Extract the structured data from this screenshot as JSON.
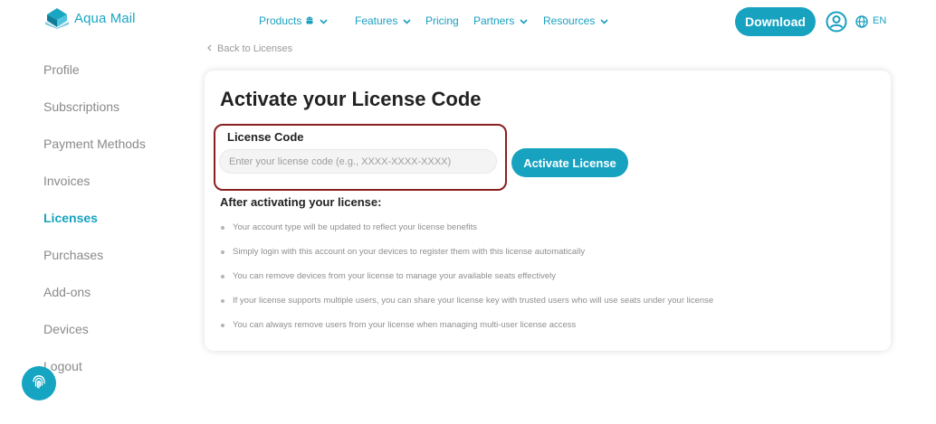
{
  "header": {
    "logo_text": "Aqua Mail",
    "nav": [
      {
        "label": "Products",
        "has_android": true,
        "has_chevron": true
      },
      {
        "label": "Features",
        "has_chevron": true
      },
      {
        "label": "Pricing",
        "has_chevron": false
      },
      {
        "label": "Partners",
        "has_chevron": true
      },
      {
        "label": "Resources",
        "has_chevron": true
      }
    ],
    "download_label": "Download",
    "language": "EN"
  },
  "colors": {
    "accent": "#17a3c0",
    "highlight_border": "#8b1f1f",
    "muted_text": "#8a8a8a"
  },
  "sidebar": {
    "items": [
      {
        "label": "Profile",
        "active": false
      },
      {
        "label": "Subscriptions",
        "active": false
      },
      {
        "label": "Payment Methods",
        "active": false
      },
      {
        "label": "Invoices",
        "active": false
      },
      {
        "label": "Licenses",
        "active": true
      },
      {
        "label": "Purchases",
        "active": false
      },
      {
        "label": "Add-ons",
        "active": false
      },
      {
        "label": "Devices",
        "active": false
      },
      {
        "label": "Logout",
        "active": false
      }
    ]
  },
  "main": {
    "back_link": "Back to Licenses",
    "title": "Activate your License Code",
    "field_label": "License Code",
    "input_placeholder": "Enter your license code (e.g., XXXX-XXXX-XXXX)",
    "input_value": "",
    "activate_label": "Activate License",
    "after_heading": "After activating your license:",
    "bullets": [
      "Your account type will be updated to reflect your license benefits",
      "Simply login with this account on your devices to register them with this license automatically",
      "You can remove devices from your license to manage your available seats effectively",
      "If your license supports multiple users, you can share your license key with trusted users who will use seats under your license",
      "You can always remove users from your license when managing multi-user license access"
    ]
  }
}
